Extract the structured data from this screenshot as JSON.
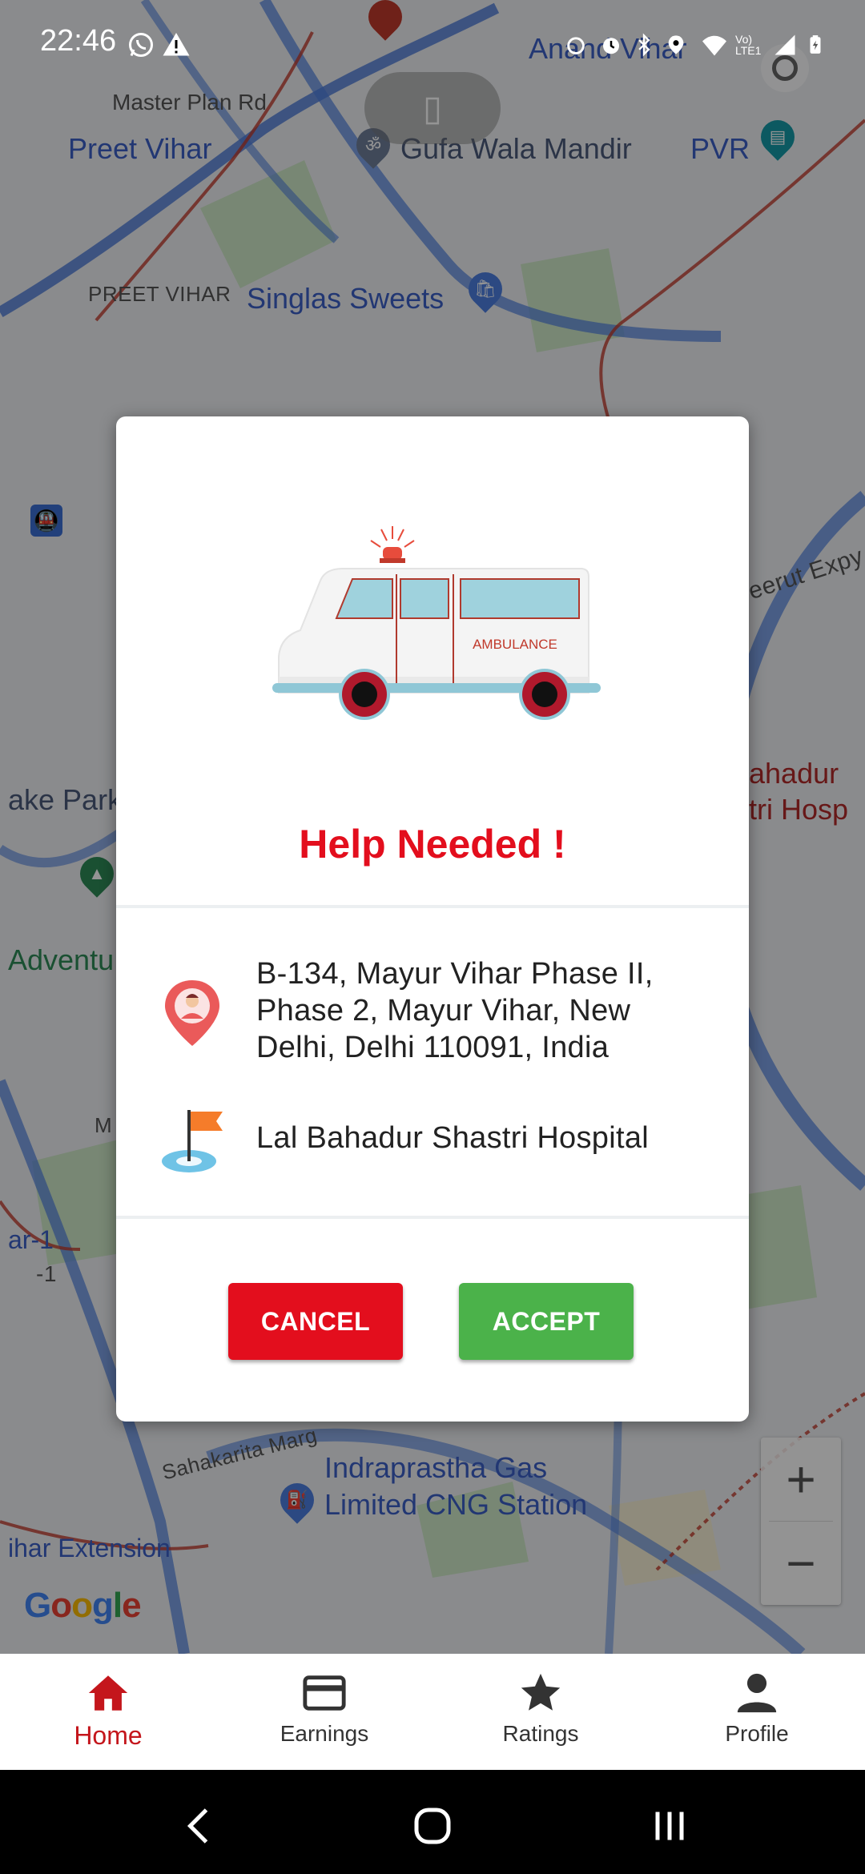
{
  "status_bar": {
    "time": "22:46",
    "left_icons": [
      "whatsapp-icon",
      "warning-icon"
    ],
    "right_icons": [
      "alarm-icon",
      "alarm-clock-icon",
      "bluetooth-icon",
      "location-icon",
      "wifi-icon",
      "volte-icon",
      "signal-icon",
      "battery-icon"
    ],
    "volte_label": "Vo) LTE1"
  },
  "map": {
    "labels": {
      "master_plan_rd": "Master Plan Rd",
      "preet_vihar": "Preet Vihar",
      "gufa_wala_mandir": "Gufa Wala Mandir",
      "pvr": "PVR",
      "preet_vihar_caps": "PREET VIHAR",
      "singlas_sweets": "Singlas Sweets",
      "anand_vihar": "Anand Vihar",
      "meerut_expy": "eerut Expy",
      "lake_park": "ake Park",
      "adventure": "Adventu",
      "bahadur_hosp_1": "ahadur",
      "bahadur_hosp_2": "tri Hosp",
      "metro_m": "M",
      "ar1": "ar-1",
      "ar1b": "-1",
      "sahakarita_marg": "Sahakarita Marg",
      "igl_1": "Indraprastha Gas",
      "igl_2": "Limited CNG Station",
      "vihar_extension": "ihar Extension"
    },
    "google_logo": "Google",
    "zoom_in": "+",
    "zoom_out": "−"
  },
  "dialog": {
    "ambulance_text": "AMBULANCE",
    "title": "Help Needed !",
    "pickup_address": "B-134, Mayur Vihar Phase II, Phase 2, Mayur Vihar, New Delhi, Delhi 110091, India",
    "destination": "Lal Bahadur Shastri Hospital",
    "cancel_label": "CANCEL",
    "accept_label": "ACCEPT",
    "colors": {
      "title": "#e30e1d",
      "cancel": "#e30e1d",
      "accept": "#4bb24a"
    }
  },
  "bottom_nav": {
    "items": [
      {
        "label": "Home",
        "icon": "home-icon",
        "active": true
      },
      {
        "label": "Earnings",
        "icon": "card-icon",
        "active": false
      },
      {
        "label": "Ratings",
        "icon": "star-icon",
        "active": false
      },
      {
        "label": "Profile",
        "icon": "person-icon",
        "active": false
      }
    ],
    "active_color": "#c4161c"
  },
  "system_nav": {
    "icons": [
      "back-icon",
      "home-circle-icon",
      "recents-icon"
    ]
  }
}
